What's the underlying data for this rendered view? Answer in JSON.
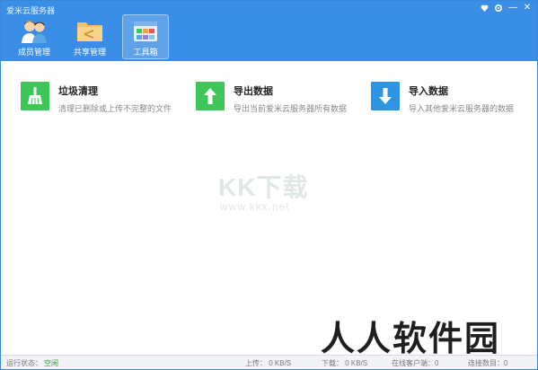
{
  "app": {
    "title": "爱米云服务器"
  },
  "window_controls": {
    "menu_icon": "heart-icon",
    "settings_icon": "gear-icon",
    "minimize": "—",
    "close": "✕"
  },
  "toolbar": {
    "items": [
      {
        "label": "成员管理",
        "icon": "members-icon"
      },
      {
        "label": "共享管理",
        "icon": "folder-share-icon"
      },
      {
        "label": "工具箱",
        "icon": "toolbox-icon"
      }
    ]
  },
  "cards": [
    {
      "title": "垃圾清理",
      "desc": "清理已删除或上传不完整的文件",
      "icon": "broom-icon",
      "color": "#3fc65a"
    },
    {
      "title": "导出数据",
      "desc": "导出当前爱米云服务器所有数据",
      "icon": "arrow-up-icon",
      "color": "#3fc65a"
    },
    {
      "title": "导入数据",
      "desc": "导入其他爱米云服务器的数据",
      "icon": "arrow-down-icon",
      "color": "#2d95e3"
    }
  ],
  "watermarks": {
    "kk": "KK下载",
    "url": "www.kkx.net",
    "rr": "人人软件园"
  },
  "status": {
    "run_label": "运行状态：",
    "run_value": "空闲",
    "upload": "上传： 0 KB/S",
    "download": "下载： 0 KB/S",
    "online": "在线客户端：0",
    "connections": "连接数目：0"
  }
}
